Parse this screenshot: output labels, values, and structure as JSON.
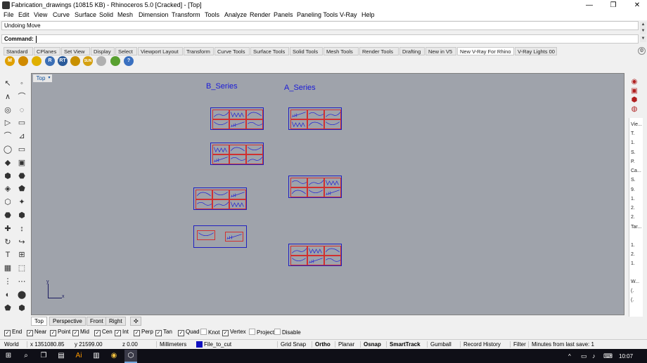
{
  "window": {
    "title": "Fabrication_drawings (10815 KB) - Rhinoceros 5.0 [Cracked] - [Top]",
    "minimize": "—",
    "maximize": "❐",
    "close": "✕"
  },
  "menu": [
    "File",
    "Edit",
    "View",
    "Curve",
    "Surface",
    "Solid",
    "Mesh",
    "Dimension",
    "Transform",
    "Tools",
    "Analyze",
    "Render",
    "Panels",
    "Paneling Tools",
    "V-Ray",
    "Help"
  ],
  "command_history": "Undoing Move",
  "command_prompt": "Command:",
  "toolbar_tabs": [
    "Standard",
    "CPlanes",
    "Set View",
    "Display",
    "Select",
    "Viewport Layout",
    "Transform",
    "Curve Tools",
    "Surface Tools",
    "Solid Tools",
    "Mesh Tools",
    "Render Tools",
    "Drafting",
    "New in V5",
    "New V-Ray For Rhino",
    "V-Ray Lights 00"
  ],
  "active_toolbar_tab": "New V-Ray For Rhino",
  "vray_icons": [
    {
      "label": "M",
      "color": "#e0a000"
    },
    {
      "label": "",
      "color": "#d08a00"
    },
    {
      "label": "",
      "color": "#e0b000"
    },
    {
      "label": "R",
      "color": "#3b6fb6"
    },
    {
      "label": "RT",
      "color": "#2a5a9a"
    },
    {
      "label": "",
      "color": "#c89000"
    },
    {
      "label": "SUN",
      "color": "#d4a010"
    },
    {
      "label": "",
      "color": "#b0b0b0"
    },
    {
      "label": "",
      "color": "#58a030"
    },
    {
      "label": "?",
      "color": "#3a70c0"
    }
  ],
  "viewport": {
    "name": "Top",
    "menu_arrow": "▾",
    "labels": {
      "b_series": "B_Series",
      "a_series": "A_Series"
    },
    "axis_x": "x",
    "axis_y": "y"
  },
  "viewport_tabs": [
    "Top",
    "Perspective",
    "Front",
    "Right"
  ],
  "viewport_add": "✣",
  "right_panel": [
    "Vie...",
    "T.",
    "1.",
    "S.",
    "P.",
    "Ca...",
    "S.",
    "9.",
    "1.",
    "2.",
    "2.",
    "Tar...",
    "1.",
    "2.",
    "1.",
    "W...",
    "(.",
    "(."
  ],
  "osnaps": [
    {
      "label": "End",
      "checked": true
    },
    {
      "label": "Near",
      "checked": true
    },
    {
      "label": "Point",
      "checked": true
    },
    {
      "label": "Mid",
      "checked": true
    },
    {
      "label": "Cen",
      "checked": true
    },
    {
      "label": "Int",
      "checked": true
    },
    {
      "label": "Perp",
      "checked": true
    },
    {
      "label": "Tan",
      "checked": true
    },
    {
      "label": "Quad",
      "checked": true
    },
    {
      "label": "Knot",
      "checked": false
    },
    {
      "label": "Vertex",
      "checked": true
    },
    {
      "label": "Project",
      "checked": false
    },
    {
      "label": "Disable",
      "checked": false
    }
  ],
  "status": {
    "cplane": "World",
    "x": "x 1351080.85",
    "y": "y 21599.00",
    "z": "z 0.00",
    "units": "Millimeters",
    "layer": "File_to_cut",
    "layer_color": "#1010c0",
    "grid_snap": "Grid Snap",
    "ortho": "Ortho",
    "planar": "Planar",
    "osnap": "Osnap",
    "smarttrack": "SmartTrack",
    "gumball": "Gumball",
    "record_history": "Record History",
    "filter": "Filter",
    "last_save": "Minutes from last save: 1"
  },
  "taskbar": {
    "icons": [
      "windows-logo",
      "search",
      "task-view",
      "file-explorer",
      "illustrator",
      "explorer-folder",
      "chrome",
      "folder",
      "rhino"
    ],
    "time": "10:07"
  },
  "colors": {
    "viewport_bg": "#9fa3ab",
    "sheet_border": "#2020c0",
    "cell_border": "#d03030",
    "curve_color": "#1a1ad8"
  }
}
